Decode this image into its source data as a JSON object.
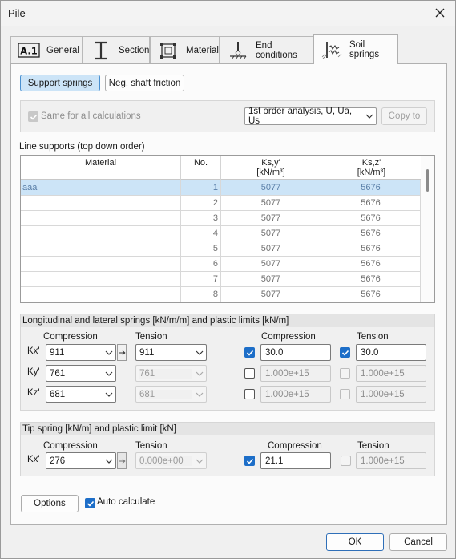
{
  "window": {
    "title": "Pile"
  },
  "tabs": [
    {
      "label": "General",
      "icon": "a1-icon"
    },
    {
      "label": "Section",
      "icon": "i-beam-icon"
    },
    {
      "label": "Material",
      "icon": "material-cube-icon"
    },
    {
      "label": "End conditions",
      "icon": "support-icon"
    },
    {
      "label": "Soil springs",
      "icon": "soil-springs-icon"
    }
  ],
  "subtabs": {
    "support_springs": "Support springs",
    "neg_shaft_friction": "Neg. shaft friction"
  },
  "settings": {
    "same_for_all_label": "Same for all calculations",
    "same_for_all_checked": true,
    "analysis_select": "1st order analysis, U, Ua, Us",
    "copy_to": "Copy to"
  },
  "line_supports": {
    "title": "Line supports (top down order)",
    "headers": {
      "material": "Material",
      "no": "No.",
      "ky_line1": "Ks,y'",
      "ky_line2": "[kN/m³]",
      "kz_line1": "Ks,z'",
      "kz_line2": "[kN/m³]"
    },
    "rows": [
      {
        "material": "aaa",
        "no": "1",
        "ky": "5077",
        "kz": "5676",
        "selected": true
      },
      {
        "material": "",
        "no": "2",
        "ky": "5077",
        "kz": "5676",
        "selected": false
      },
      {
        "material": "",
        "no": "3",
        "ky": "5077",
        "kz": "5676",
        "selected": false
      },
      {
        "material": "",
        "no": "4",
        "ky": "5077",
        "kz": "5676",
        "selected": false
      },
      {
        "material": "",
        "no": "5",
        "ky": "5077",
        "kz": "5676",
        "selected": false
      },
      {
        "material": "",
        "no": "6",
        "ky": "5077",
        "kz": "5676",
        "selected": false
      },
      {
        "material": "",
        "no": "7",
        "ky": "5077",
        "kz": "5676",
        "selected": false
      },
      {
        "material": "",
        "no": "8",
        "ky": "5077",
        "kz": "5676",
        "selected": false
      }
    ]
  },
  "springs": {
    "title": "Longitudinal and lateral springs [kN/m/m] and plastic limits [kN/m]",
    "col_compression": "Compression",
    "col_tension": "Tension",
    "col_limit_compression": "Compression",
    "col_limit_tension": "Tension",
    "rows": [
      {
        "label": "Kx'",
        "compression": "911",
        "tension": "911",
        "tension_enabled": true,
        "lim_c_checked": true,
        "lim_c": "30.0",
        "lim_t_checked": true,
        "lim_t": "30.0"
      },
      {
        "label": "Ky'",
        "compression": "761",
        "tension": "761",
        "tension_enabled": false,
        "lim_c_checked": false,
        "lim_c": "1.000e+15",
        "lim_t_checked": false,
        "lim_t": "1.000e+15"
      },
      {
        "label": "Kz'",
        "compression": "681",
        "tension": "681",
        "tension_enabled": false,
        "lim_c_checked": false,
        "lim_c": "1.000e+15",
        "lim_t_checked": false,
        "lim_t": "1.000e+15"
      }
    ]
  },
  "tip": {
    "title": "Tip spring [kN/m] and plastic limit [kN]",
    "col_compression": "Compression",
    "col_tension": "Tension",
    "col_limit_compression": "Compression",
    "col_limit_tension": "Tension",
    "row": {
      "label": "Kx'",
      "compression": "276",
      "tension": "0.000e+00",
      "lim_c_checked": true,
      "lim_c": "21.1",
      "lim_t_checked": false,
      "lim_t": "1.000e+15"
    }
  },
  "footer": {
    "options": "Options",
    "auto_calculate": "Auto calculate",
    "auto_checked": true
  },
  "dialog": {
    "ok": "OK",
    "cancel": "Cancel"
  },
  "colors": {
    "accent": "#1d6ec8",
    "selected_row": "#cce4f7"
  }
}
